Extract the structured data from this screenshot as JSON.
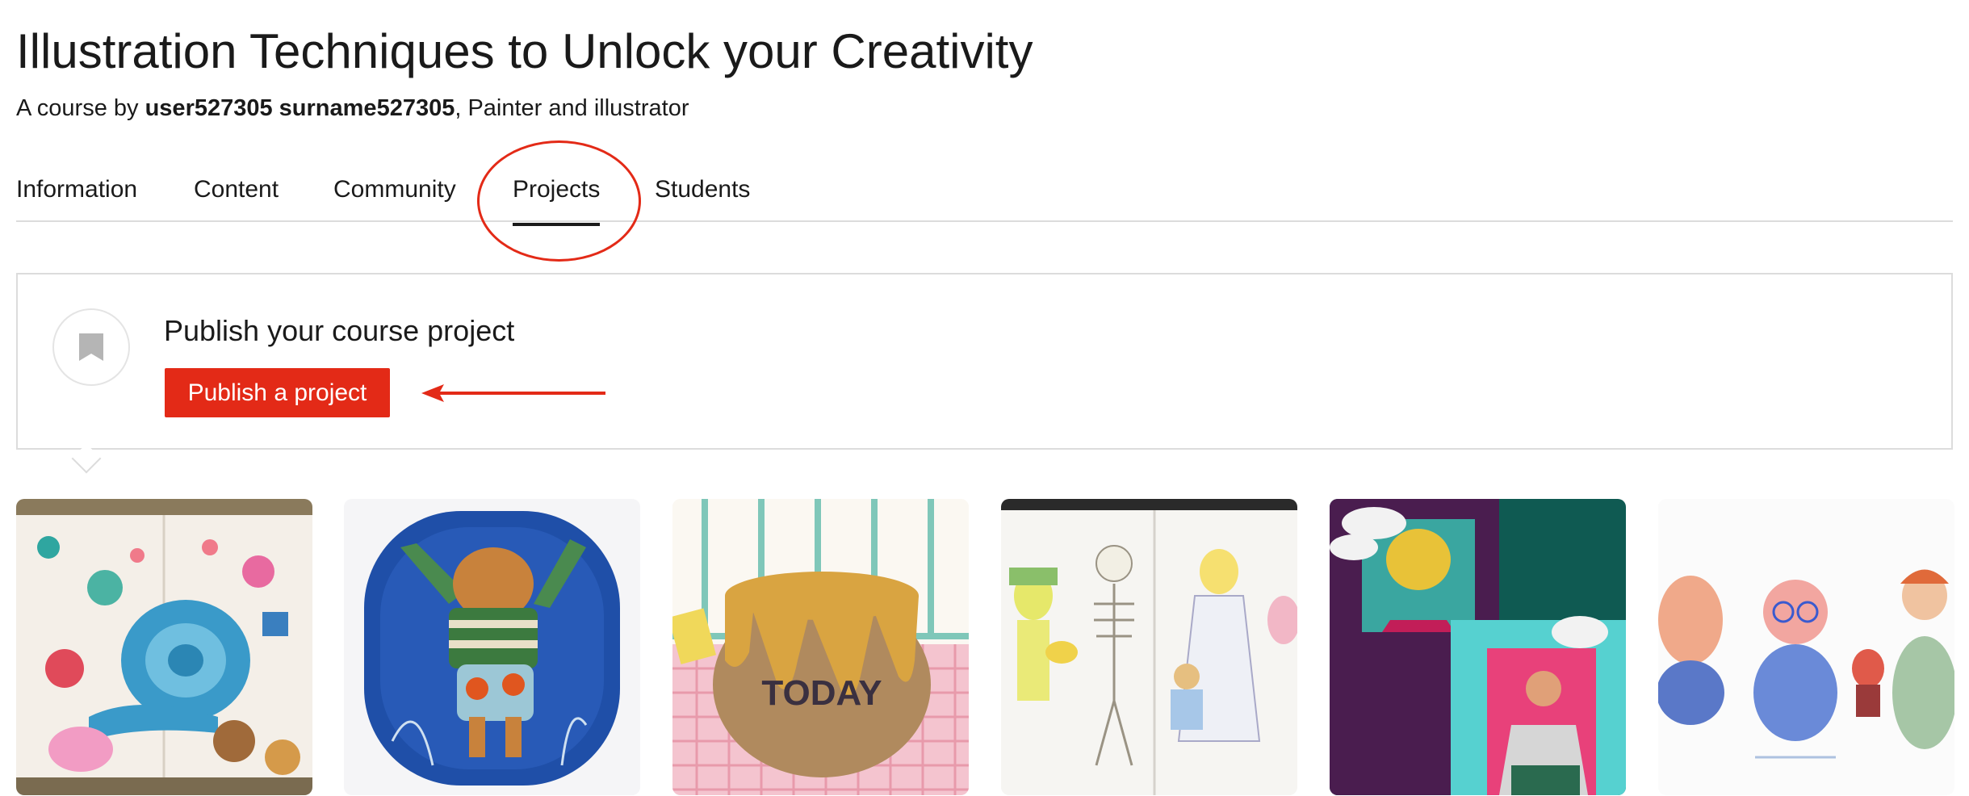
{
  "course": {
    "title": "Illustration Techniques to Unlock your Creativity",
    "by_prefix": "A course by ",
    "author": "user527305 surname527305",
    "author_suffix": ", Painter and illustrator"
  },
  "tabs": [
    {
      "label": "Information",
      "active": false
    },
    {
      "label": "Content",
      "active": false
    },
    {
      "label": "Community",
      "active": false
    },
    {
      "label": "Projects",
      "active": true
    },
    {
      "label": "Students",
      "active": false
    }
  ],
  "publish_panel": {
    "title": "Publish your course project",
    "button_label": "Publish a project",
    "icon": "bookmark-icon"
  },
  "projects": [
    {
      "name": "snail-illustrations"
    },
    {
      "name": "fox-in-sweater"
    },
    {
      "name": "honey-pot-today",
      "label": "TODAY"
    },
    {
      "name": "marionette-sketches"
    },
    {
      "name": "smoking-portraits"
    },
    {
      "name": "whimsical-characters"
    }
  ],
  "colors": {
    "accent": "#e32a17",
    "text": "#1a1a1a",
    "border": "#dcdcdc"
  }
}
